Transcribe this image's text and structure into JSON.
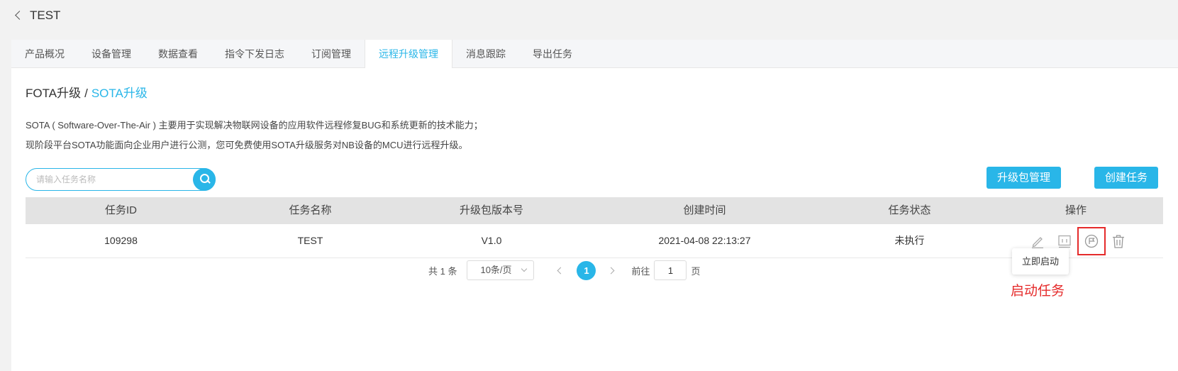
{
  "header": {
    "title": "TEST",
    "back_icon": "chevron-left-icon"
  },
  "tabs": [
    {
      "label": "产品概况",
      "active": false
    },
    {
      "label": "设备管理",
      "active": false
    },
    {
      "label": "数据查看",
      "active": false
    },
    {
      "label": "指令下发日志",
      "active": false
    },
    {
      "label": "订阅管理",
      "active": false
    },
    {
      "label": "远程升级管理",
      "active": true
    },
    {
      "label": "消息跟踪",
      "active": false
    },
    {
      "label": "导出任务",
      "active": false
    }
  ],
  "breadcrumb": {
    "first": "FOTA升级",
    "separator": "/",
    "current": "SOTA升级"
  },
  "description": {
    "line1": "SOTA ( Software-Over-The-Air ) 主要用于实现解决物联网设备的应用软件远程修复BUG和系统更新的技术能力；",
    "line2": "现阶段平台SOTA功能面向企业用户进行公测，您可免费使用SOTA升级服务对NB设备的MCU进行远程升级。"
  },
  "search": {
    "placeholder": "请输入任务名称",
    "value": "",
    "icon": "search-icon"
  },
  "buttons": {
    "package_manage": "升级包管理",
    "create_task": "创建任务"
  },
  "table": {
    "columns": [
      "任务ID",
      "任务名称",
      "升级包版本号",
      "创建时间",
      "任务状态",
      "操作"
    ],
    "rows": [
      {
        "id": "109298",
        "name": "TEST",
        "version": "V1.0",
        "created": "2021-04-08 22:13:27",
        "status": "未执行",
        "actions": [
          "edit-icon",
          "monitor-icon",
          "start-task-icon",
          "delete-icon"
        ]
      }
    ]
  },
  "tooltip": {
    "text": "立即启动"
  },
  "annotation": {
    "text": "启动任务",
    "color": "#e52b2b"
  },
  "pagination": {
    "total": "共 1 条",
    "page_size": "10条/页",
    "current_page": "1",
    "goto_label": "前往",
    "goto_value": "1",
    "page_unit": "页"
  },
  "colors": {
    "accent": "#29b6e8",
    "highlight": "#e52b2b"
  }
}
